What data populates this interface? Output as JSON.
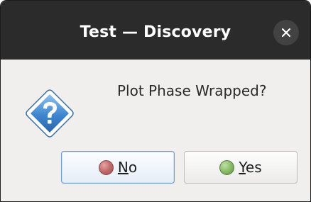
{
  "window": {
    "title": "Test — Discovery",
    "close_icon": "close-icon"
  },
  "dialog": {
    "icon": "question-icon",
    "message": "Plot Phase Wrapped?"
  },
  "buttons": {
    "no": {
      "mnemonic": "N",
      "rest": "o",
      "icon": "red-dot-icon",
      "color": "#b86262"
    },
    "yes": {
      "mnemonic": "Y",
      "rest": "es",
      "icon": "green-dot-icon",
      "color": "#7fb25e"
    }
  },
  "colors": {
    "titlebar": "#2b2b2b",
    "body": "#f0efee",
    "focus_border": "#6d9bce",
    "question_icon": "#3d7fc7"
  }
}
